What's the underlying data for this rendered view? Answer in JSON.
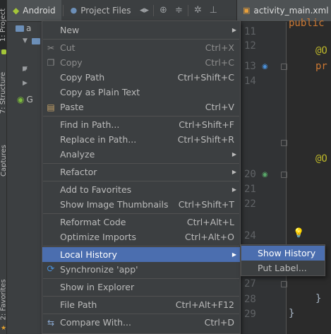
{
  "tool_strip": {
    "project_tab": "1: Project",
    "structure_tab": "7: Structure",
    "captures_tab": "Captures",
    "favorites_tab": "2: Favorites"
  },
  "project_toolbar": {
    "view_selector": "Android",
    "project_files_tab": "Project Files"
  },
  "tree": {
    "root_fragment": "a",
    "gradle_fragment": "G"
  },
  "editor": {
    "tab_label": "activity_main.xml",
    "line_numbers": [
      "11",
      "12",
      "13",
      "14",
      "20",
      "21",
      "22",
      "24",
      "27",
      "28",
      "29"
    ],
    "code_fragments": [
      "public",
      "@O",
      "pr",
      "@O",
      "}",
      "}"
    ]
  },
  "context_menu": {
    "items": [
      {
        "label": "New",
        "shortcut": "",
        "submenu": true
      },
      {
        "label": "Cut",
        "shortcut": "Ctrl+X",
        "disabled": true
      },
      {
        "label": "Copy",
        "shortcut": "Ctrl+C",
        "disabled": true
      },
      {
        "label": "Copy Path",
        "shortcut": "Ctrl+Shift+C"
      },
      {
        "label": "Copy as Plain Text",
        "shortcut": ""
      },
      {
        "label": "Paste",
        "shortcut": "Ctrl+V"
      },
      {
        "label": "Find in Path...",
        "shortcut": "Ctrl+Shift+F"
      },
      {
        "label": "Replace in Path...",
        "shortcut": "Ctrl+Shift+R"
      },
      {
        "label": "Analyze",
        "shortcut": "",
        "submenu": true
      },
      {
        "label": "Refactor",
        "shortcut": "",
        "submenu": true
      },
      {
        "label": "Add to Favorites",
        "shortcut": "",
        "submenu": true
      },
      {
        "label": "Show Image Thumbnails",
        "shortcut": "Ctrl+Shift+T"
      },
      {
        "label": "Reformat Code",
        "shortcut": "Ctrl+Alt+L"
      },
      {
        "label": "Optimize Imports",
        "shortcut": "Ctrl+Alt+O"
      },
      {
        "label": "Local History",
        "shortcut": "",
        "submenu": true,
        "highlighted": true
      },
      {
        "label": "Synchronize 'app'",
        "shortcut": ""
      },
      {
        "label": "Show in Explorer",
        "shortcut": ""
      },
      {
        "label": "File Path",
        "shortcut": "Ctrl+Alt+F12"
      },
      {
        "label": "Compare With...",
        "shortcut": "Ctrl+D"
      }
    ]
  },
  "local_history_submenu": {
    "items": [
      {
        "label": "Show History",
        "highlighted": true
      },
      {
        "label": "Put Label..."
      }
    ]
  },
  "colors": {
    "menu_background": "#3c3f41",
    "highlight": "#4b6eaf",
    "editor_background": "#2b2b2b",
    "annotation": "#bbb529",
    "keyword": "#cc7832"
  }
}
